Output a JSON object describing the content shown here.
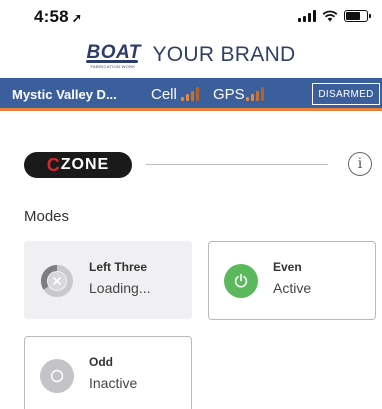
{
  "status_bar": {
    "time": "4:58",
    "location_icon": "location-arrow-icon",
    "signal_icon": "cellular-signal-icon",
    "wifi_icon": "wifi-icon",
    "battery_icon": "battery-icon"
  },
  "brand": {
    "logo_word": "BOAT",
    "logo_tagline": "FABRICATION WORK",
    "name": "YOUR BRAND"
  },
  "info_bar": {
    "vessel_name": "Mystic Valley D...",
    "cell_label": "Cell",
    "gps_label": "GPS",
    "arm_button_label": "DISARMED",
    "background_color": "#3b5f9c",
    "accent_color": "#e6803a"
  },
  "czone": {
    "logo_c": "C",
    "logo_text": "ZONE",
    "info_icon": "info-circle-icon",
    "info_glyph": "i"
  },
  "modes": {
    "heading": "Modes",
    "items": [
      {
        "title": "Left Three",
        "status": "Loading...",
        "icon": "spinner-close-icon"
      },
      {
        "title": "Even",
        "status": "Active",
        "icon": "power-icon",
        "color": "#5cb85c"
      },
      {
        "title": "Odd",
        "status": "Inactive",
        "icon": "circle-off-icon",
        "color": "#c4c4c8"
      }
    ]
  }
}
